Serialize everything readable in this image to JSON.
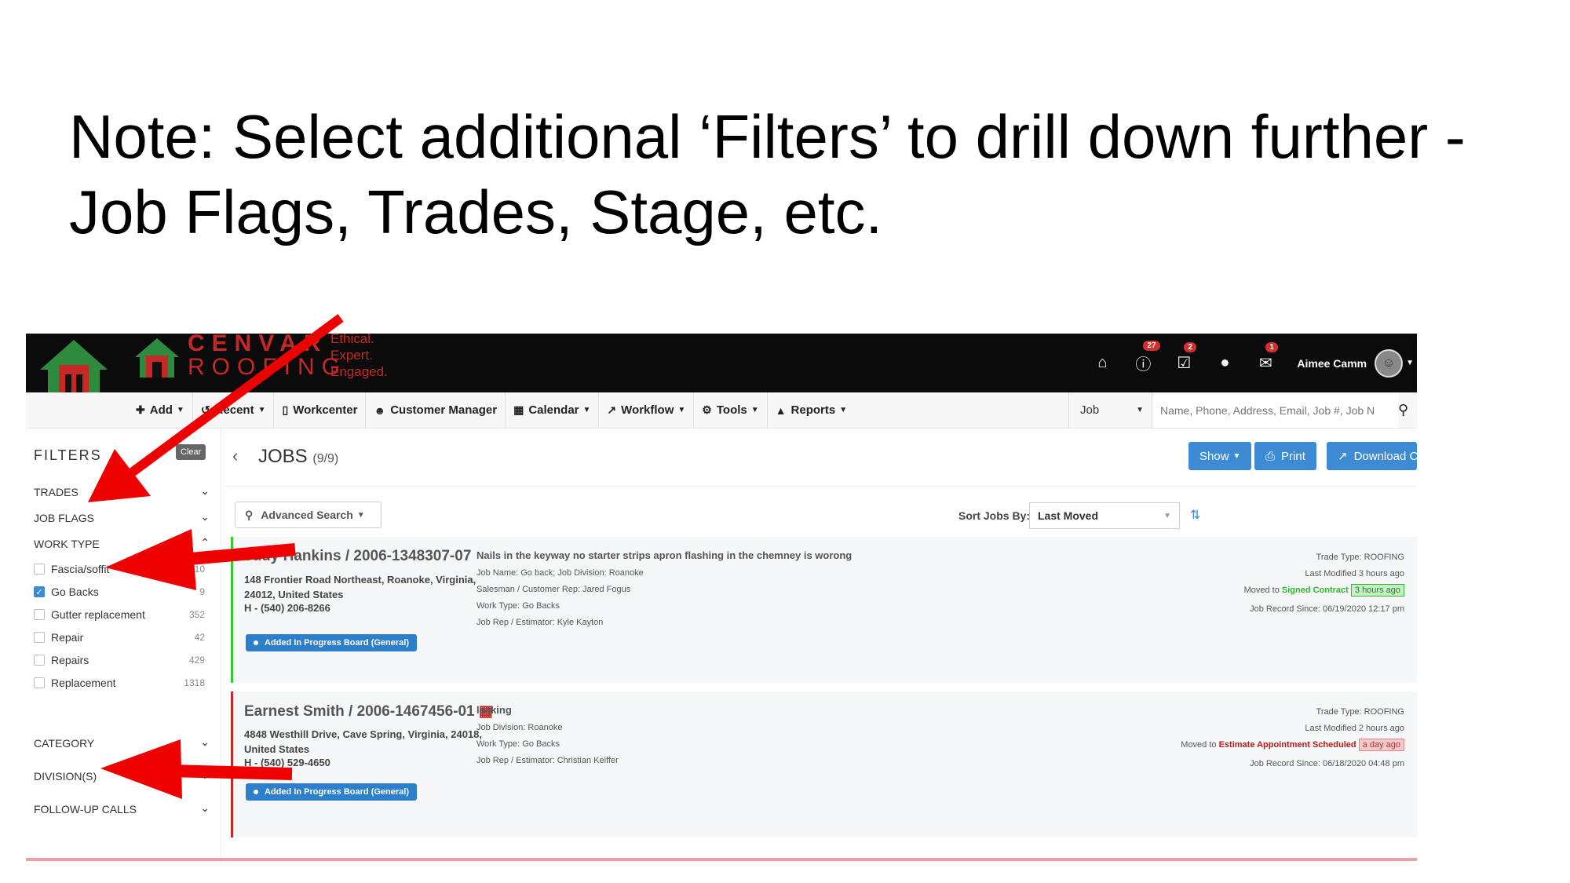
{
  "note": {
    "line1": "Note: Select additional ‘Filters’ to drill down further -",
    "line2": "Job Flags, Trades, Stage, etc."
  },
  "brand": {
    "line1": "CENVAR",
    "line2": "ROOFING",
    "slogan1": "Ethical.",
    "slogan2": "Expert.",
    "slogan3": "Engaged."
  },
  "topbar": {
    "alerts_badge": "27",
    "tasks_badge": "2",
    "mail_badge": "1",
    "user_name": "Aimee Camm"
  },
  "nav": {
    "add": "Add",
    "recent": "Recent",
    "workcenter": "Workcenter",
    "customer_manager": "Customer Manager",
    "calendar": "Calendar",
    "workflow": "Workflow",
    "tools": "Tools",
    "reports": "Reports",
    "search_type": "Job",
    "search_placeholder": "Name, Phone, Address, Email, Job #, Job N"
  },
  "filters": {
    "title": "FILTERS",
    "clear": "Clear",
    "trades": "TRADES",
    "job_flags": "JOB FLAGS",
    "work_type": "WORK TYPE",
    "options": [
      {
        "label": "Fascia/soffit",
        "count": "10",
        "checked": false
      },
      {
        "label": "Go Backs",
        "count": "9",
        "checked": true
      },
      {
        "label": "Gutter replacement",
        "count": "352",
        "checked": false
      },
      {
        "label": "Repair",
        "count": "42",
        "checked": false
      },
      {
        "label": "Repairs",
        "count": "429",
        "checked": false
      },
      {
        "label": "Replacement",
        "count": "1318",
        "checked": false
      }
    ],
    "category": "CATEGORY",
    "divisions": "DIVISION(S)",
    "follow_up": "FOLLOW-UP CALLS"
  },
  "main": {
    "title": "JOBS",
    "count": "(9/9)",
    "show": "Show",
    "print": "Print",
    "download": "Download CSV",
    "advanced_search": "Advanced Search",
    "sort_label": "Sort Jobs By:",
    "sort_value": "Last Moved"
  },
  "jobs": [
    {
      "name": "Judy Hankins / 2006-1348307-07",
      "address": "148 Frontier Road Northeast, Roanoke, Virginia, 24012, United States",
      "phone": "H - (540) 206-8266",
      "pill": "Added In Progress Board (General)",
      "desc": "Nails in the keyway no starter strips apron flashing in the chemney is worong",
      "line1": "Job Name:   Go back;   Job Division:   Roanoke",
      "line2": "Salesman / Customer Rep:   Jared Fogus",
      "line3": "Work Type:   Go Backs",
      "line4": "Job Rep / Estimator:    Kyle Kayton",
      "trade": "Trade Type: ROOFING",
      "modified": "Last Modified 3 hours ago",
      "moved_prefix": "Moved to ",
      "moved_stage": "Signed Contract",
      "moved_ago": "3 hours ago",
      "since": "Job Record Since: 06/19/2020 12:17 pm"
    },
    {
      "name": "Earnest Smith / 2006-1467456-01",
      "address": "4848 Westhill Drive, Cave Spring, Virginia, 24018, United States",
      "phone": "H - (540) 529-4650",
      "pill": "Added In Progress Board (General)",
      "desc": "leaking",
      "line1": "Job Division:   Roanoke",
      "line2": "Work Type:   Go Backs",
      "line3": "Job Rep / Estimator:    Christian Keiffer",
      "trade": "Trade Type: ROOFING",
      "modified": "Last Modified 2 hours ago",
      "moved_prefix": "Moved to ",
      "moved_stage": "Estimate Appointment Scheduled",
      "moved_ago": "a day ago",
      "since": "Job Record Since: 06/18/2020 04:48 pm"
    }
  ],
  "colors": {
    "accent": "#3d8bd4",
    "annotation_arrow": "#ee0000",
    "brand": "#c62828"
  }
}
